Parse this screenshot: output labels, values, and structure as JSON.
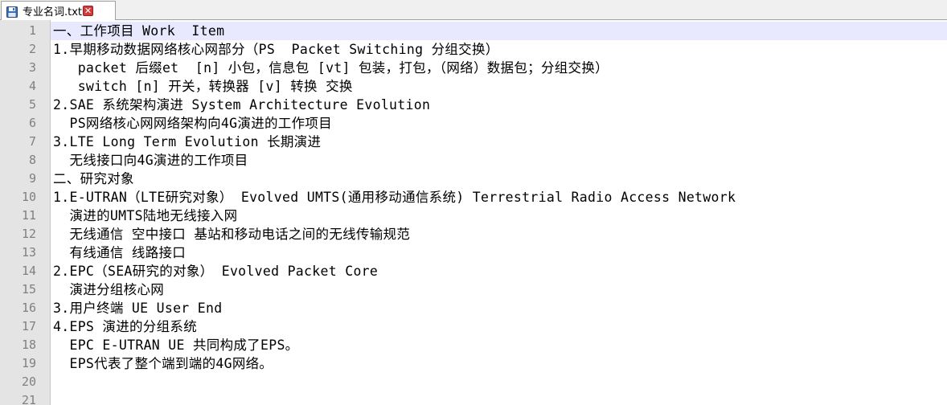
{
  "tab": {
    "filename": "专业名词.txt",
    "close_symbol": "✕"
  },
  "colors": {
    "active_line": "#e8e8ff",
    "gutter_bg": "#e4e4e4",
    "line_number": "#808080",
    "close_button": "#d13b3b"
  },
  "icons": {
    "save": "floppy-disk-icon",
    "close": "close-icon"
  },
  "editor": {
    "active_line": 1,
    "lines": [
      {
        "num": "1",
        "text": "一、工作项目 Work  Item"
      },
      {
        "num": "2",
        "text": "1.早期移动数据网络核心网部分（PS  Packet Switching 分组交换）"
      },
      {
        "num": "3",
        "text": "   packet 后缀et  [n] 小包，信息包 [vt] 包装，打包，（网络）数据包；分组交换）"
      },
      {
        "num": "4",
        "text": "   switch [n] 开关，转换器 [v] 转换 交换"
      },
      {
        "num": "5",
        "text": "2.SAE 系统架构演进 System Architecture Evolution"
      },
      {
        "num": "6",
        "text": "  PS网络核心网网络架构向4G演进的工作项目"
      },
      {
        "num": "7",
        "text": "3.LTE Long Term Evolution 长期演进"
      },
      {
        "num": "8",
        "text": "  无线接口向4G演进的工作项目"
      },
      {
        "num": "9",
        "text": "二、研究对象"
      },
      {
        "num": "10",
        "text": "1.E-UTRAN（LTE研究对象） Evolved UMTS(通用移动通信系统) Terrestrial Radio Access Network"
      },
      {
        "num": "11",
        "text": "  演进的UMTS陆地无线接入网"
      },
      {
        "num": "12",
        "text": "  无线通信 空中接口 基站和移动电话之间的无线传输规范"
      },
      {
        "num": "13",
        "text": "  有线通信 线路接口"
      },
      {
        "num": "14",
        "text": "2.EPC（SEA研究的对象） Evolved Packet Core"
      },
      {
        "num": "15",
        "text": "  演进分组核心网"
      },
      {
        "num": "16",
        "text": "3.用户终端 UE User End"
      },
      {
        "num": "17",
        "text": "4.EPS 演进的分组系统"
      },
      {
        "num": "18",
        "text": "  EPC E-UTRAN UE 共同构成了EPS。"
      },
      {
        "num": "19",
        "text": "  EPS代表了整个端到端的4G网络。"
      },
      {
        "num": "20",
        "text": ""
      },
      {
        "num": "21",
        "text": ""
      }
    ]
  }
}
